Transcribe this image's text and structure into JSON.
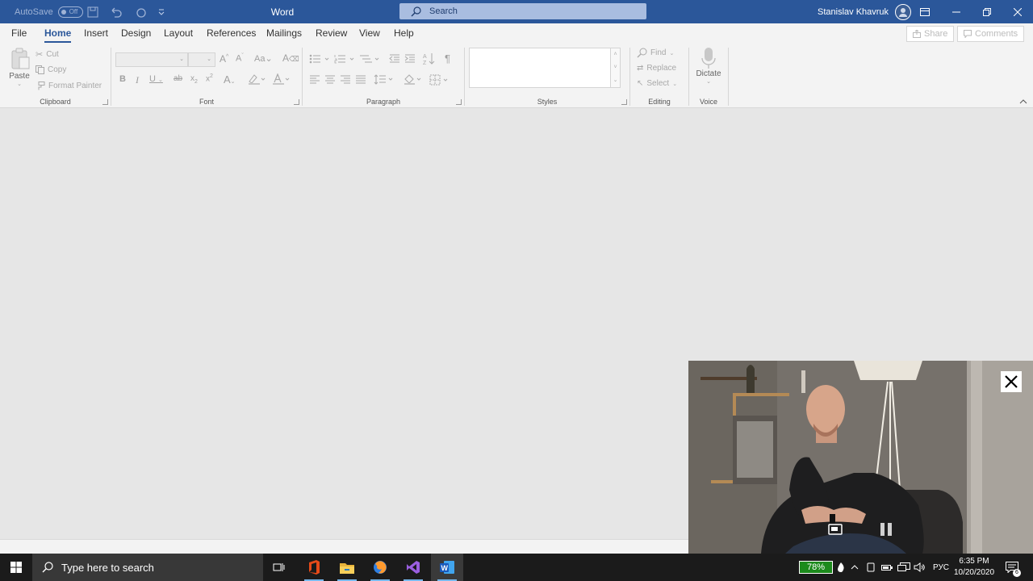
{
  "titlebar": {
    "autosave_label": "AutoSave",
    "autosave_state": "Off",
    "app_title": "Word",
    "search_placeholder": "Search",
    "user_name": "Stanislav Khavruk"
  },
  "tabs": [
    "File",
    "Home",
    "Insert",
    "Design",
    "Layout",
    "References",
    "Mailings",
    "Review",
    "View",
    "Help"
  ],
  "active_tab": "Home",
  "share_label": "Share",
  "comments_label": "Comments",
  "ribbon": {
    "clipboard": {
      "label": "Clipboard",
      "paste": "Paste",
      "cut": "Cut",
      "copy": "Copy",
      "format_painter": "Format Painter"
    },
    "font": {
      "label": "Font"
    },
    "paragraph": {
      "label": "Paragraph"
    },
    "styles": {
      "label": "Styles"
    },
    "editing": {
      "label": "Editing",
      "find": "Find",
      "replace": "Replace",
      "select": "Select"
    },
    "voice": {
      "label": "Voice",
      "dictate": "Dictate"
    }
  },
  "taskbar": {
    "search_placeholder": "Type here to search",
    "battery": "78%",
    "language": "РУС",
    "time": "6:35 PM",
    "date": "10/20/2020",
    "notifications": "6"
  },
  "colors": {
    "accent": "#2b579a",
    "battery_fill": "#1c8a1c",
    "taskbar": "#1b1b1b"
  },
  "icons": [
    "windows-logo-icon",
    "search-icon",
    "task-view-icon",
    "office-icon",
    "file-explorer-icon",
    "firefox-icon",
    "visual-studio-icon",
    "word-icon",
    "close-icon",
    "pause-icon",
    "picture-in-picture-icon"
  ]
}
